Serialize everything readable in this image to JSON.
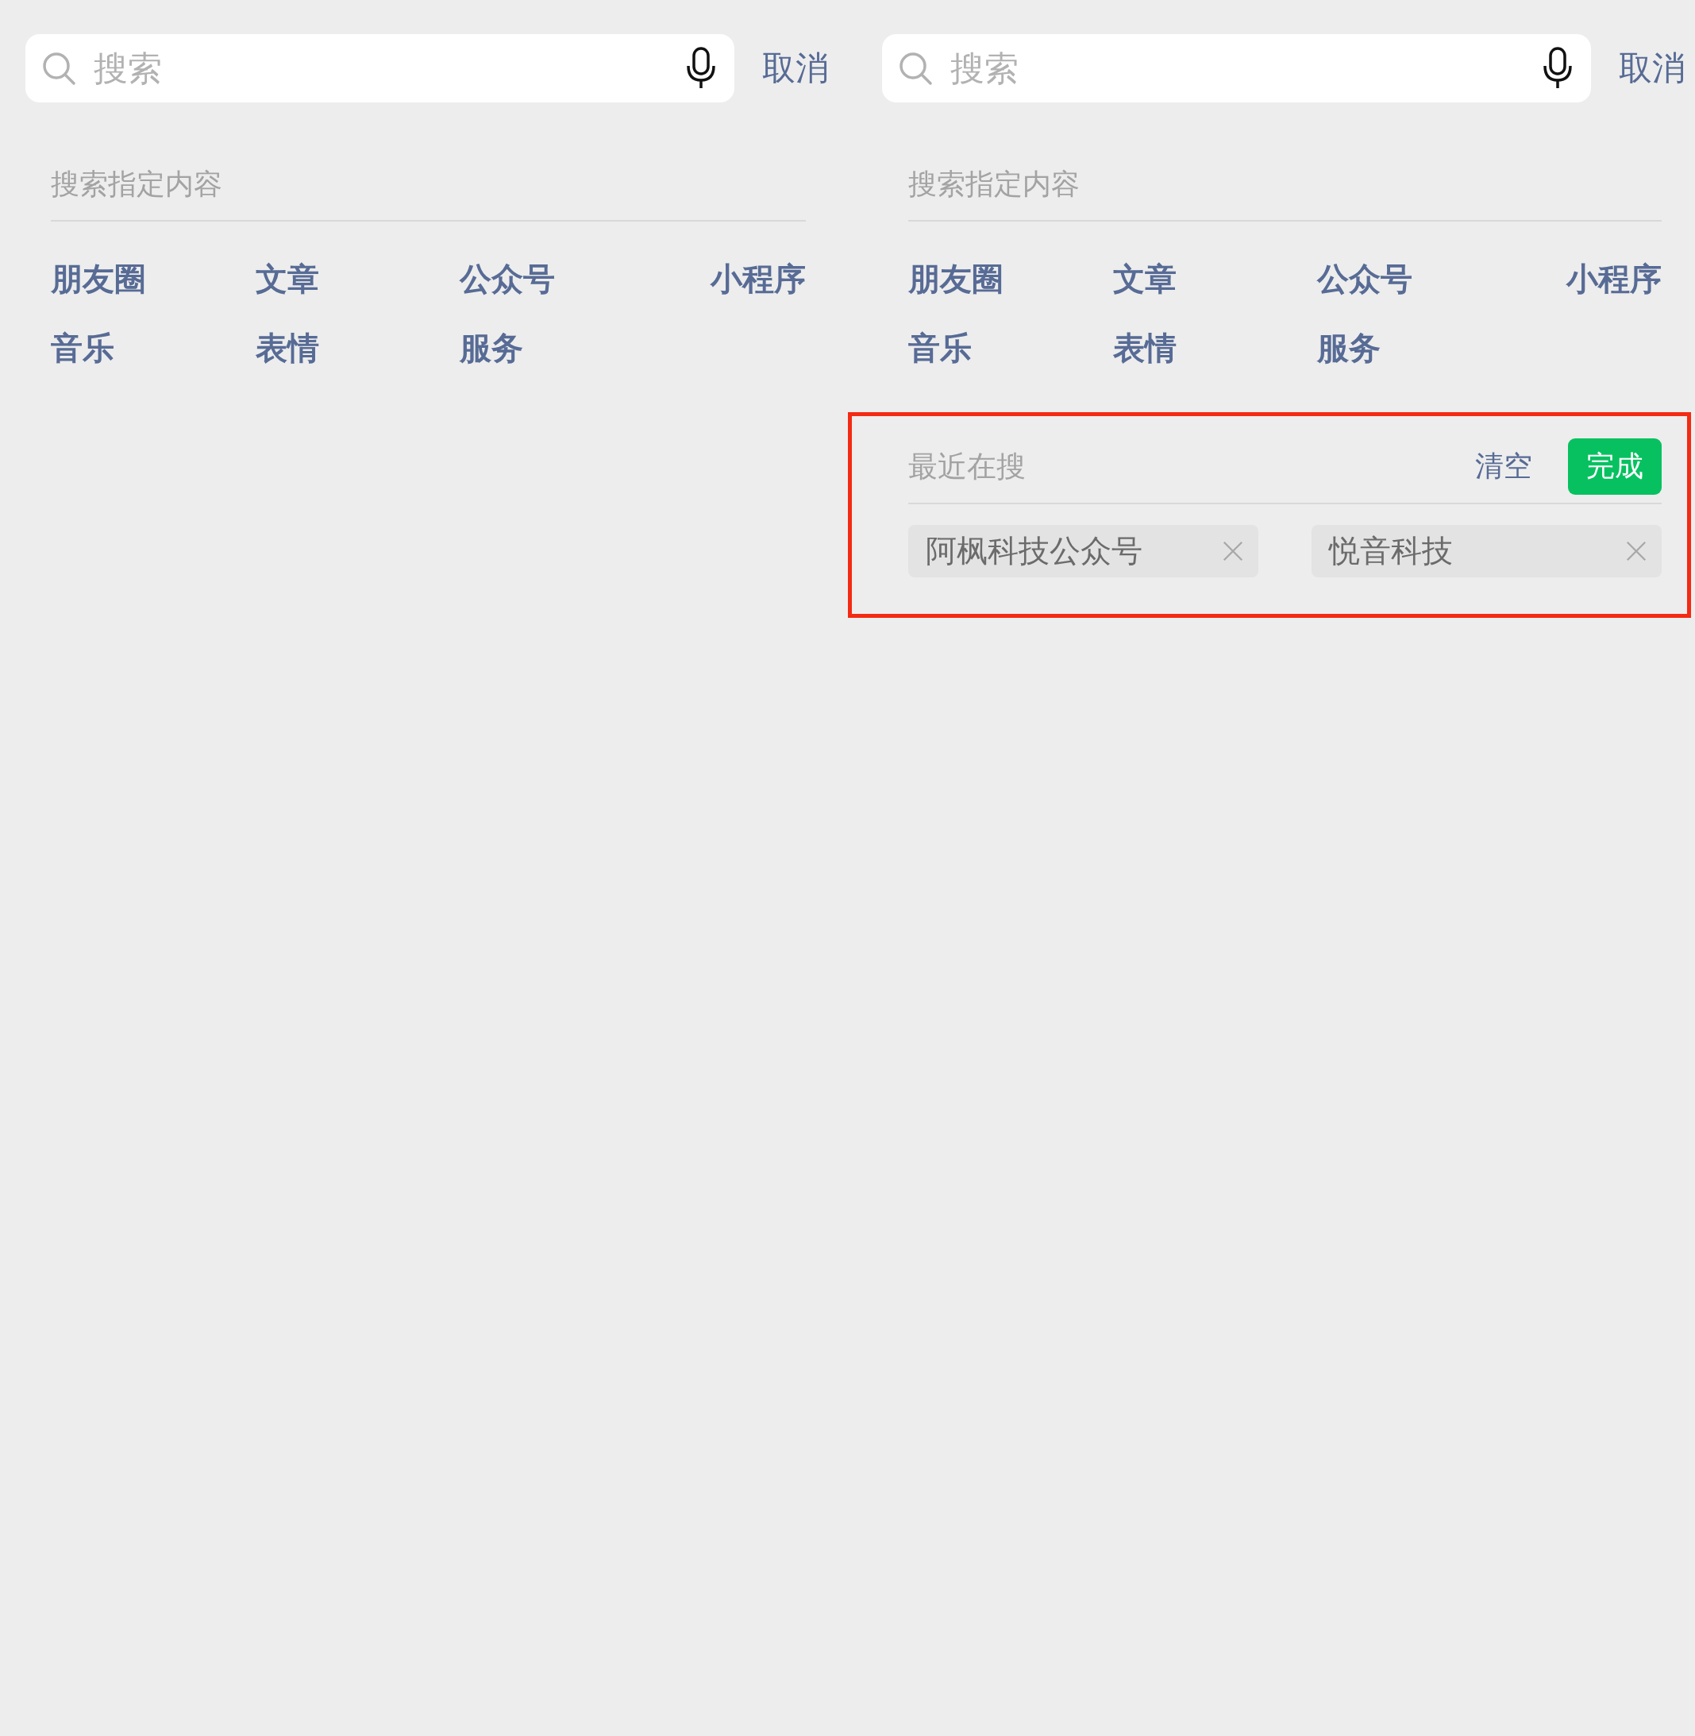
{
  "panels": [
    {
      "search": {
        "placeholder": "搜索"
      },
      "cancel": "取消",
      "section_title": "搜索指定内容",
      "categories": [
        "朋友圈",
        "文章",
        "公众号",
        "小程序",
        "音乐",
        "表情",
        "服务"
      ]
    },
    {
      "search": {
        "placeholder": "搜索"
      },
      "cancel": "取消",
      "section_title": "搜索指定内容",
      "categories": [
        "朋友圈",
        "文章",
        "公众号",
        "小程序",
        "音乐",
        "表情",
        "服务"
      ],
      "recent": {
        "highlighted": true,
        "title": "最近在搜",
        "clear": "清空",
        "done": "完成",
        "items": [
          "阿枫科技公众号",
          "悦音科技"
        ]
      }
    }
  ]
}
